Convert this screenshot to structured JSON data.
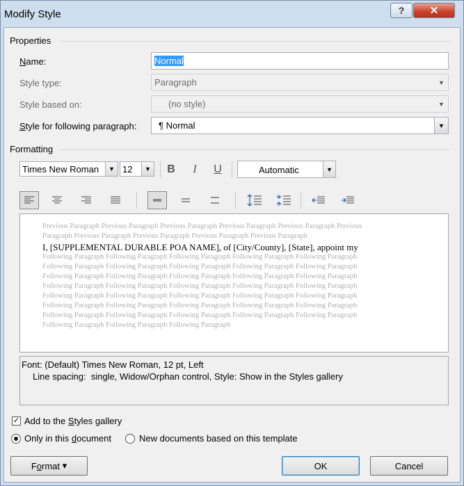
{
  "window": {
    "title": "Modify Style",
    "help_label": "?",
    "close_label": "✕"
  },
  "properties": {
    "section_label": "Properties",
    "name": {
      "label_pre": "",
      "label_ul": "N",
      "label_post": "ame:",
      "value": "Normal"
    },
    "style_type": {
      "label": "Style type:",
      "value": "Paragraph"
    },
    "based_on": {
      "label": "Style based on:",
      "value": "(no style)"
    },
    "following": {
      "label_ul": "S",
      "label_post": "tyle for following paragraph:",
      "value": "Normal",
      "pilcrow": "¶"
    }
  },
  "formatting": {
    "section_label": "Formatting",
    "font": "Times New Roman",
    "size": "12",
    "bold": "B",
    "italic": "I",
    "underline": "U",
    "color": "Automatic"
  },
  "preview": {
    "prev_line1": "Previous Paragraph Previous Paragraph Previous Paragraph Previous Paragraph Previous Paragraph Previous",
    "prev_line2": "Paragraph Previous Paragraph Previous Paragraph Previous Paragraph Previous Paragraph",
    "main_line": "I, [SUPPLEMENTAL DURABLE POA NAME], of [City/County], [State], appoint my",
    "follow_line": "Following Paragraph Following Paragraph Following Paragraph Following Paragraph Following Paragraph",
    "follow_last": "Following Paragraph Following Paragraph Following Paragraph"
  },
  "description": {
    "line1": "Font: (Default) Times New Roman, 12 pt, Left",
    "line2": "Line spacing:  single, Widow/Orphan control, Style: Show in the Styles gallery"
  },
  "options": {
    "add_gallery_pre": "Add to the ",
    "add_gallery_ul": "S",
    "add_gallery_post": "tyles gallery",
    "only_doc_pre": "Only in this ",
    "only_doc_ul": "d",
    "only_doc_post": "ocument",
    "new_docs": "New documents based on this template"
  },
  "buttons": {
    "format_pre": "F",
    "format_ul": "o",
    "format_post": "rmat",
    "format_arrow": "▾",
    "ok": "OK",
    "cancel": "Cancel"
  }
}
